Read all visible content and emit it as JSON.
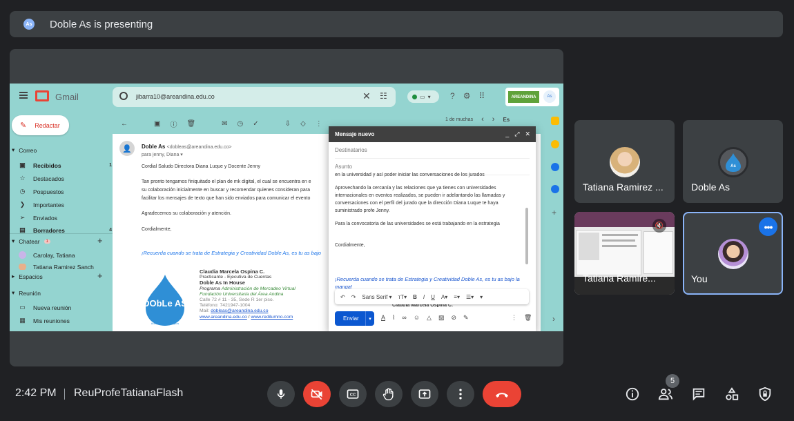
{
  "top_bar": {
    "presenter_text": "Doble As is presenting",
    "logo_text": "Doble As"
  },
  "gmail": {
    "product": "Gmail",
    "search_value": "jibarra10@areandina.edu.co",
    "brand": "AREANDINA",
    "compose": "Redactar",
    "sections": {
      "correo": "Correo",
      "chatear": "Chatear",
      "chat_badge": "1",
      "espacios": "Espacios",
      "reunion": "Reunión"
    },
    "folders": [
      {
        "label": "Recibidos",
        "count": "1",
        "icon": "inbox-icon",
        "bold": true
      },
      {
        "label": "Destacados",
        "count": "",
        "icon": "star-icon",
        "bold": false
      },
      {
        "label": "Pospuestos",
        "count": "",
        "icon": "clock-icon",
        "bold": false
      },
      {
        "label": "Importantes",
        "count": "",
        "icon": "label-important-icon",
        "bold": false
      },
      {
        "label": "Enviados",
        "count": "",
        "icon": "send-icon",
        "bold": false
      },
      {
        "label": "Borradores",
        "count": "4",
        "icon": "draft-icon",
        "bold": true
      }
    ],
    "chats": [
      "Carolay, Tatiana",
      "Tatiana Ramirez Sanch"
    ],
    "meeting_items": [
      "Nueva reunión",
      "Mis reuniones"
    ],
    "pager": {
      "text": "1 de muchas",
      "lang": "Es"
    },
    "email": {
      "from_name": "Doble As",
      "from_addr": "<dobleas@areandina.edu.co>",
      "to": "para jenny, Diana",
      "lines": [
        "Cordial Saludo Directora Diana Luque y Docente Jenny",
        "Tan pronto tengamos finiquitado el plan de mk digital, el  cual se encuentra en e",
        "su colaboración inicialmente en buscar y recomendar quienes consideran  para",
        "facilitar  los mensajes de texto que han sido enviados para comunicar el evento",
        "Agradecemos su colaboración y atención.",
        "Cordialmente,"
      ],
      "tagline": "¡Recuerda cuando se trata de Estrategia y Creatividad Doble As, es tu as bajo",
      "signature": {
        "name": "Claudia Marcela Ospina C.",
        "role": "Practicante - Ejecutiva de Cuentas",
        "company": "Doble As In House",
        "program_label": "Programa",
        "program": "Administración de Mercadeo Virtual",
        "university": "Fundación Universitaria del Área Andina",
        "address": "Calle 72 # 11 - 35, Sede R 1er piso.",
        "phone": "Teléfono: 7421947-1004",
        "mail_label": "Mail:",
        "mail": "dobleas@areandina.edu.co",
        "web1": "www.areandina.edu.co",
        "web_sep": " / ",
        "web2": "www.redilumno.com",
        "logo_text": "DObLe AS",
        "logo_sub": "Advertising & Analytics"
      }
    },
    "compose_window": {
      "title": "Mensaje nuevo",
      "to_placeholder": "Destinatarios",
      "subject_placeholder": "Asunto",
      "body": [
        "en la universidad y  así poder iniciar las conversaciones de los jurados",
        "Aprovechando la cercanía y las relaciones que ya tienes con universidades",
        "internacionales en eventos realizados, se pueden ir adelantando las llamadas y",
        "conversaciones con el perfil del jurado que la dirección Diana Luque te haya",
        "suministrado profe Jenny.",
        "Para la convocatoria de las universidades se está trabajando en la estrategia",
        "Cordialmente,"
      ],
      "tagline": "¡Recuerda cuando se trata de Estrategia y Creatividad Doble As, es tu as bajo la manga!",
      "font": "Sans Serif",
      "send": "Enviar",
      "peek": "Claudia Marcela Ospina C."
    }
  },
  "participants": [
    {
      "name": "Tatiana Ramirez ...",
      "avatar": "avatar-tatiana"
    },
    {
      "name": "Doble As",
      "avatar": "avatar-dobleas"
    },
    {
      "name": "Tatiana Ramire...",
      "avatar": "screen-share-thumbnail"
    },
    {
      "name": "You",
      "avatar": "avatar-you"
    }
  ],
  "bottom": {
    "time": "2:42 PM",
    "meeting_code": "ReuProfeTatianaFlash",
    "people_count": "5"
  },
  "colors": {
    "background": "#202124",
    "surface": "#3c4043",
    "end_call": "#ea4335",
    "accent": "#8ab4f8"
  }
}
